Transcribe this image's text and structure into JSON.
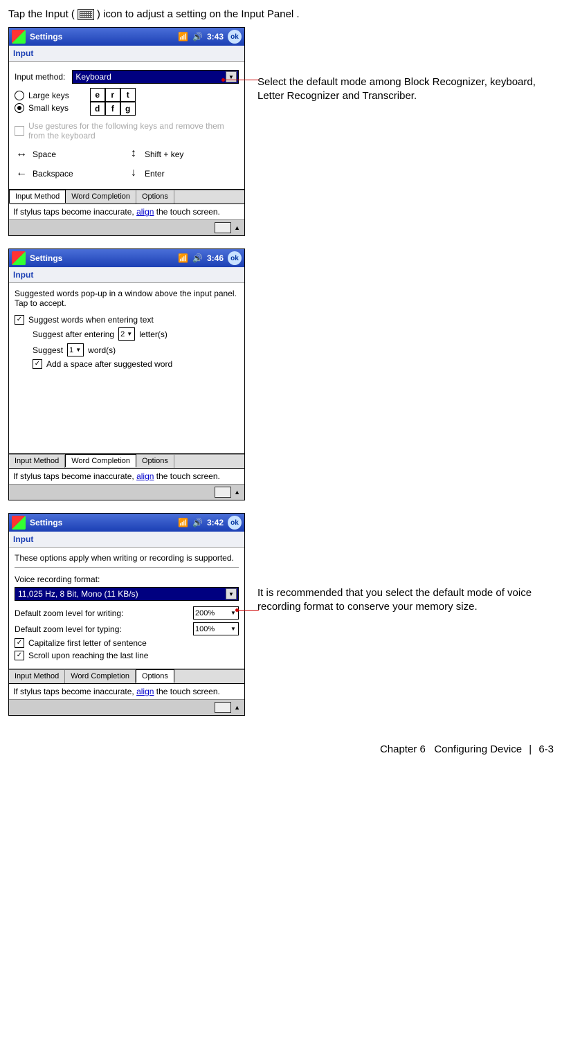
{
  "intro": {
    "text_before": "Tap the Input (",
    "text_after": ") icon to adjust a setting on the Input Panel ."
  },
  "annotations": {
    "a1": "Select the default mode among Block Recognizer, keyboard, Letter Recognizer and Transcriber.",
    "a3": "It is recommended that you select the default mode of voice recording format to conserve your memory size."
  },
  "common": {
    "title": "Settings",
    "subheader": "Input",
    "ok": "ok",
    "hint_before": "If stylus taps become inaccurate, ",
    "hint_link": "align",
    "hint_after": " the touch screen.",
    "tabs": {
      "t1": "Input Method",
      "t2": "Word Completion",
      "t3": "Options"
    }
  },
  "screen1": {
    "time": "3:43",
    "label_input_method": "Input method:",
    "select_value": "Keyboard",
    "radio_large": "Large keys",
    "radio_small": "Small keys",
    "keys": {
      "r1": [
        "e",
        "r",
        "t"
      ],
      "r2": [
        "d",
        "f",
        "g"
      ]
    },
    "gesture_text": "Use gestures for the following keys and remove them from the keyboard",
    "g_space": "Space",
    "g_shift": "Shift + key",
    "g_back": "Backspace",
    "g_enter": "Enter"
  },
  "screen2": {
    "time": "3:46",
    "desc": "Suggested words pop-up in a window above the input panel.  Tap to accept.",
    "cb1": "Suggest words when entering text",
    "line2a": "Suggest after entering",
    "line2b": "letter(s)",
    "dd1": "2",
    "line3a": "Suggest",
    "line3b": "word(s)",
    "dd2": "1",
    "cb2": "Add a space after suggested word"
  },
  "screen3": {
    "time": "3:42",
    "desc": "These options apply when writing or recording is supported.",
    "label_voice": "Voice recording format:",
    "voice_value": "11,025 Hz, 8 Bit, Mono (11 KB/s)",
    "label_zoom_write": "Default zoom level for writing:",
    "zoom_write": "200%",
    "label_zoom_type": "Default zoom level for typing:",
    "zoom_type": "100%",
    "cb_cap": "Capitalize first letter of sentence",
    "cb_scroll": "Scroll upon reaching the last line"
  },
  "footer": {
    "chapter": "Chapter 6",
    "title": "Configuring Device",
    "page": "6-3"
  }
}
